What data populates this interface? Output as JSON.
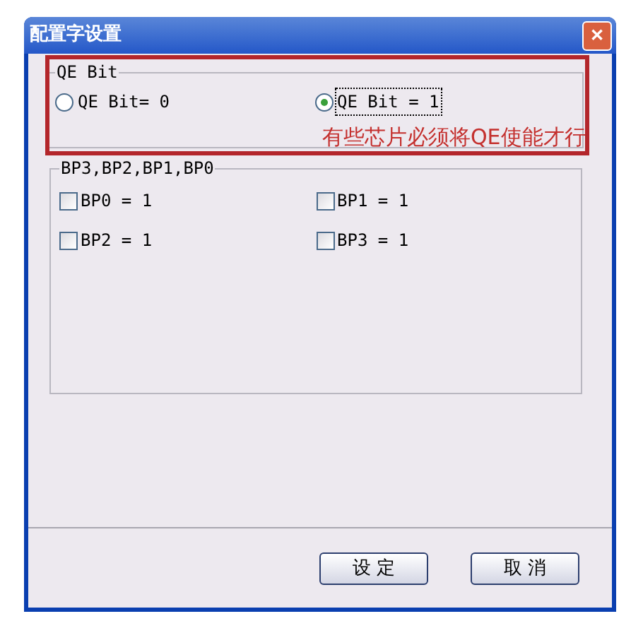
{
  "window": {
    "title": "配置字设置",
    "close": "✕"
  },
  "qe_group": {
    "title": "QE Bit",
    "options": [
      {
        "label": "QE Bit= 0",
        "selected": false
      },
      {
        "label": "QE Bit = 1",
        "selected": true
      }
    ]
  },
  "annotation": {
    "text": "有些芯片必须将QE使能才行"
  },
  "bp_group": {
    "title": "BP3,BP2,BP1,BP0",
    "checkboxes": [
      {
        "label": "BP0 = 1",
        "checked": false
      },
      {
        "label": "BP1 = 1",
        "checked": false
      },
      {
        "label": "BP2 = 1",
        "checked": false
      },
      {
        "label": "BP3 = 1",
        "checked": false
      }
    ]
  },
  "buttons": [
    "设 定",
    "取 消"
  ]
}
